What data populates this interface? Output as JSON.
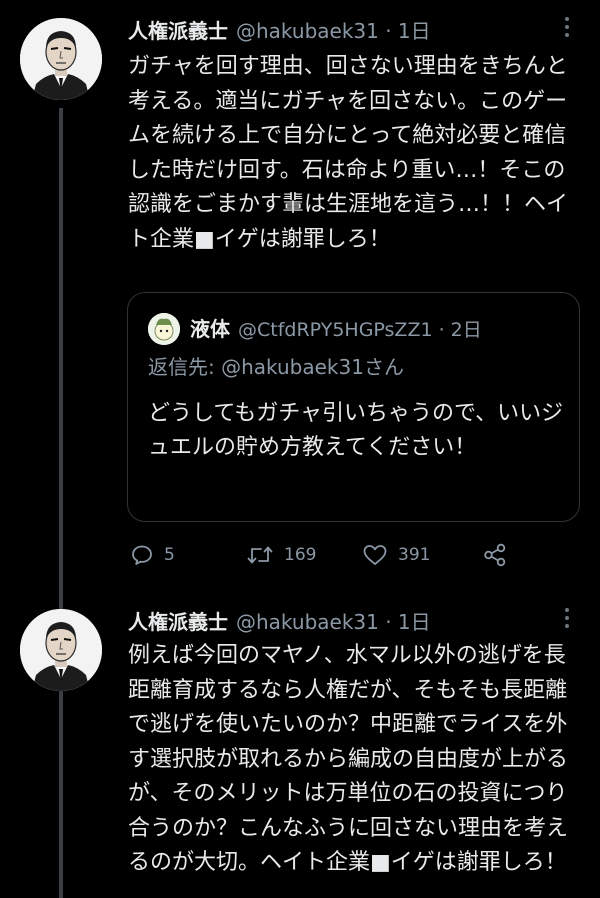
{
  "tweets": [
    {
      "author_name": "人権派義士",
      "meta": "@hakubaek31 · 1日",
      "text": "ガチャを回す理由、回さない理由をきちんと考える。適当にガチャを回さない。このゲームを続ける上で自分にとって絶対必要と確信した時だけ回す。石は命より重い…！そこの認識をごまかす輩は生涯地を這う…！！ヘイト企業■イゲは謝罪しろ！",
      "quote": {
        "author_name": "液体",
        "meta": "@CtfdRPY5HGPsZZ1 · 2日",
        "reply_to": "返信先: @hakubaek31さん",
        "text": "どうしてもガチャ引いちゃうので、いいジュエルの貯め方教えてください！"
      },
      "actions": {
        "replies": "5",
        "retweets": "169",
        "likes": "391"
      }
    },
    {
      "author_name": "人権派義士",
      "meta": "@hakubaek31 · 1日",
      "text": "例えば今回のマヤノ、水マル以外の逃げを長距離育成するなら人権だが、そもそも長距離で逃げを使いたいのか？中距離でライスを外す選択肢が取れるから編成の自由度が上がるが、そのメリットは万単位の石の投資につり合うのか？こんなふうに回さない理由を考えるのが大切。ヘイト企業■イゲは謝罪しろ！"
    }
  ],
  "colors": {
    "background": "#000000",
    "text": "#e7e9ea",
    "muted": "#8b98a5",
    "border": "#2f3336"
  },
  "icons": [
    "reply-icon",
    "retweet-icon",
    "like-icon",
    "share-icon",
    "more-icon"
  ]
}
